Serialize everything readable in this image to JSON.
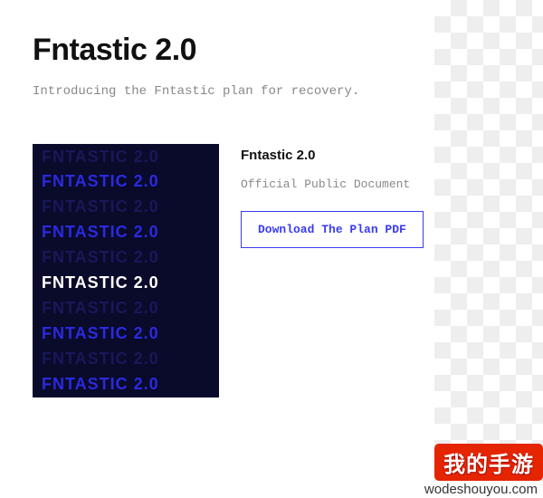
{
  "header": {
    "title": "Fntastic 2.0",
    "subtitle": "Introducing the Fntastic plan for recovery."
  },
  "cover": {
    "lines": [
      {
        "text": "FNTASTIC 2.0",
        "style": "dark"
      },
      {
        "text": "FNTASTIC 2.0",
        "style": "blue"
      },
      {
        "text": "FNTASTIC 2.0",
        "style": "dark"
      },
      {
        "text": "FNTASTIC 2.0",
        "style": "blue"
      },
      {
        "text": "FNTASTIC 2.0",
        "style": "dark"
      },
      {
        "text": "FNTASTIC 2.0",
        "style": "white"
      },
      {
        "text": "FNTASTIC 2.0",
        "style": "dark"
      },
      {
        "text": "FNTASTIC 2.0",
        "style": "blue"
      },
      {
        "text": "FNTASTIC 2.0",
        "style": "dark"
      },
      {
        "text": "FNTASTIC 2.0",
        "style": "blue"
      }
    ]
  },
  "document": {
    "title": "Fntastic 2.0",
    "subtitle": "Official Public Document",
    "button_label": "Download The Plan PDF"
  },
  "watermark": {
    "brand": "我的手游",
    "url": "wodeshouyou.com"
  }
}
